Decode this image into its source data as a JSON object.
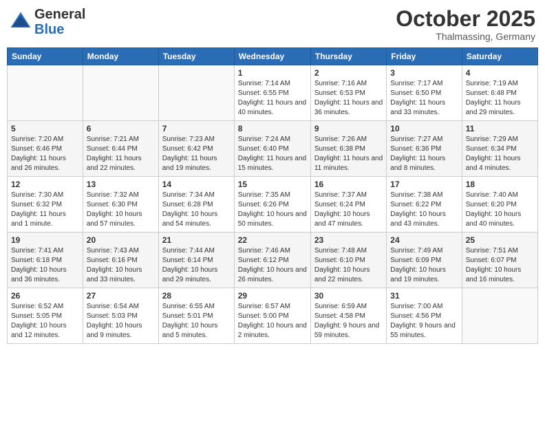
{
  "header": {
    "logo_general": "General",
    "logo_blue": "Blue",
    "month_title": "October 2025",
    "location": "Thalmassing, Germany"
  },
  "days_of_week": [
    "Sunday",
    "Monday",
    "Tuesday",
    "Wednesday",
    "Thursday",
    "Friday",
    "Saturday"
  ],
  "weeks": [
    [
      {
        "day": "",
        "info": ""
      },
      {
        "day": "",
        "info": ""
      },
      {
        "day": "",
        "info": ""
      },
      {
        "day": "1",
        "info": "Sunrise: 7:14 AM\nSunset: 6:55 PM\nDaylight: 11 hours and 40 minutes."
      },
      {
        "day": "2",
        "info": "Sunrise: 7:16 AM\nSunset: 6:53 PM\nDaylight: 11 hours and 36 minutes."
      },
      {
        "day": "3",
        "info": "Sunrise: 7:17 AM\nSunset: 6:50 PM\nDaylight: 11 hours and 33 minutes."
      },
      {
        "day": "4",
        "info": "Sunrise: 7:19 AM\nSunset: 6:48 PM\nDaylight: 11 hours and 29 minutes."
      }
    ],
    [
      {
        "day": "5",
        "info": "Sunrise: 7:20 AM\nSunset: 6:46 PM\nDaylight: 11 hours and 26 minutes."
      },
      {
        "day": "6",
        "info": "Sunrise: 7:21 AM\nSunset: 6:44 PM\nDaylight: 11 hours and 22 minutes."
      },
      {
        "day": "7",
        "info": "Sunrise: 7:23 AM\nSunset: 6:42 PM\nDaylight: 11 hours and 19 minutes."
      },
      {
        "day": "8",
        "info": "Sunrise: 7:24 AM\nSunset: 6:40 PM\nDaylight: 11 hours and 15 minutes."
      },
      {
        "day": "9",
        "info": "Sunrise: 7:26 AM\nSunset: 6:38 PM\nDaylight: 11 hours and 11 minutes."
      },
      {
        "day": "10",
        "info": "Sunrise: 7:27 AM\nSunset: 6:36 PM\nDaylight: 11 hours and 8 minutes."
      },
      {
        "day": "11",
        "info": "Sunrise: 7:29 AM\nSunset: 6:34 PM\nDaylight: 11 hours and 4 minutes."
      }
    ],
    [
      {
        "day": "12",
        "info": "Sunrise: 7:30 AM\nSunset: 6:32 PM\nDaylight: 11 hours and 1 minute."
      },
      {
        "day": "13",
        "info": "Sunrise: 7:32 AM\nSunset: 6:30 PM\nDaylight: 10 hours and 57 minutes."
      },
      {
        "day": "14",
        "info": "Sunrise: 7:34 AM\nSunset: 6:28 PM\nDaylight: 10 hours and 54 minutes."
      },
      {
        "day": "15",
        "info": "Sunrise: 7:35 AM\nSunset: 6:26 PM\nDaylight: 10 hours and 50 minutes."
      },
      {
        "day": "16",
        "info": "Sunrise: 7:37 AM\nSunset: 6:24 PM\nDaylight: 10 hours and 47 minutes."
      },
      {
        "day": "17",
        "info": "Sunrise: 7:38 AM\nSunset: 6:22 PM\nDaylight: 10 hours and 43 minutes."
      },
      {
        "day": "18",
        "info": "Sunrise: 7:40 AM\nSunset: 6:20 PM\nDaylight: 10 hours and 40 minutes."
      }
    ],
    [
      {
        "day": "19",
        "info": "Sunrise: 7:41 AM\nSunset: 6:18 PM\nDaylight: 10 hours and 36 minutes."
      },
      {
        "day": "20",
        "info": "Sunrise: 7:43 AM\nSunset: 6:16 PM\nDaylight: 10 hours and 33 minutes."
      },
      {
        "day": "21",
        "info": "Sunrise: 7:44 AM\nSunset: 6:14 PM\nDaylight: 10 hours and 29 minutes."
      },
      {
        "day": "22",
        "info": "Sunrise: 7:46 AM\nSunset: 6:12 PM\nDaylight: 10 hours and 26 minutes."
      },
      {
        "day": "23",
        "info": "Sunrise: 7:48 AM\nSunset: 6:10 PM\nDaylight: 10 hours and 22 minutes."
      },
      {
        "day": "24",
        "info": "Sunrise: 7:49 AM\nSunset: 6:09 PM\nDaylight: 10 hours and 19 minutes."
      },
      {
        "day": "25",
        "info": "Sunrise: 7:51 AM\nSunset: 6:07 PM\nDaylight: 10 hours and 16 minutes."
      }
    ],
    [
      {
        "day": "26",
        "info": "Sunrise: 6:52 AM\nSunset: 5:05 PM\nDaylight: 10 hours and 12 minutes."
      },
      {
        "day": "27",
        "info": "Sunrise: 6:54 AM\nSunset: 5:03 PM\nDaylight: 10 hours and 9 minutes."
      },
      {
        "day": "28",
        "info": "Sunrise: 6:55 AM\nSunset: 5:01 PM\nDaylight: 10 hours and 5 minutes."
      },
      {
        "day": "29",
        "info": "Sunrise: 6:57 AM\nSunset: 5:00 PM\nDaylight: 10 hours and 2 minutes."
      },
      {
        "day": "30",
        "info": "Sunrise: 6:59 AM\nSunset: 4:58 PM\nDaylight: 9 hours and 59 minutes."
      },
      {
        "day": "31",
        "info": "Sunrise: 7:00 AM\nSunset: 4:56 PM\nDaylight: 9 hours and 55 minutes."
      },
      {
        "day": "",
        "info": ""
      }
    ]
  ]
}
